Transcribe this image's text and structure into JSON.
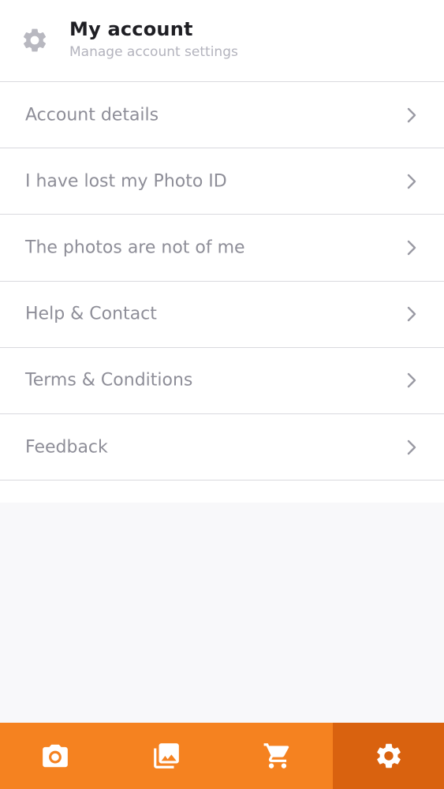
{
  "header": {
    "icon": "gear-icon",
    "title": "My account",
    "subtitle": "Manage account settings"
  },
  "menu": {
    "items": [
      {
        "label": "Account details",
        "icon": "chevron-right-icon"
      },
      {
        "label": "I have lost my Photo ID",
        "icon": "chevron-right-icon"
      },
      {
        "label": "The photos are not of me",
        "icon": "chevron-right-icon"
      },
      {
        "label": "Help & Contact",
        "icon": "chevron-right-icon"
      },
      {
        "label": "Terms & Conditions",
        "icon": "chevron-right-icon"
      },
      {
        "label": "Feedback",
        "icon": "chevron-right-icon"
      }
    ]
  },
  "tabbar": {
    "tabs": [
      {
        "icon": "camera-icon",
        "active": false
      },
      {
        "icon": "gallery-icon",
        "active": false
      },
      {
        "icon": "cart-icon",
        "active": false
      },
      {
        "icon": "settings-gear-icon",
        "active": true
      }
    ],
    "colors": {
      "background": "#f58220",
      "active": "#d9620f",
      "icon": "#ffffff"
    }
  },
  "colors": {
    "title": "#1f1f24",
    "subtitle": "#b3b3bd",
    "menu_text": "#8e8e98",
    "divider": "#d9d9de",
    "empty_area": "#f8f8fa"
  }
}
